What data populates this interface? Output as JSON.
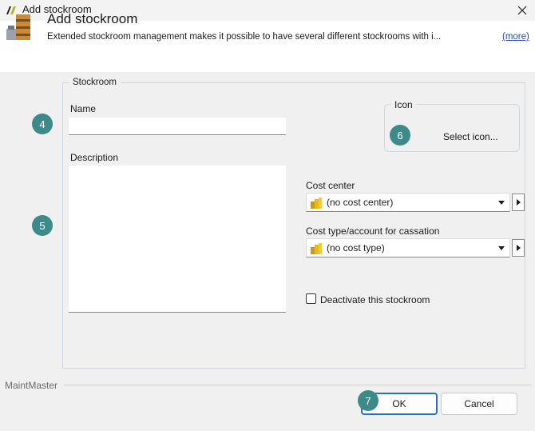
{
  "window": {
    "title": "Add stockroom",
    "close_icon": "close-icon"
  },
  "header": {
    "title": "Add stockroom",
    "description": "Extended stockroom management makes it possible to have several different stockrooms with i...",
    "more_link": "(more)",
    "icon": "stockroom-shelf-icon"
  },
  "form": {
    "group_label": "Stockroom",
    "name_label": "Name",
    "name_value": "",
    "description_label": "Description",
    "description_value": "",
    "icon_group_label": "Icon",
    "select_icon_label": "Select icon...",
    "cost_center_label": "Cost center",
    "cost_center_value": "(no cost center)",
    "cost_type_label": "Cost type/account for cassation",
    "cost_type_value": "(no cost type)",
    "deactivate_label": "Deactivate this stockroom",
    "deactivate_checked": false
  },
  "badges": {
    "b4": "4",
    "b5": "5",
    "b6": "6",
    "b7": "7"
  },
  "footer": {
    "brand": "MaintMaster",
    "ok_label": "OK",
    "cancel_label": "Cancel"
  },
  "colors": {
    "accent": "#2b6fc4",
    "badge": "#3d8a8a",
    "link": "#2a49c8"
  }
}
